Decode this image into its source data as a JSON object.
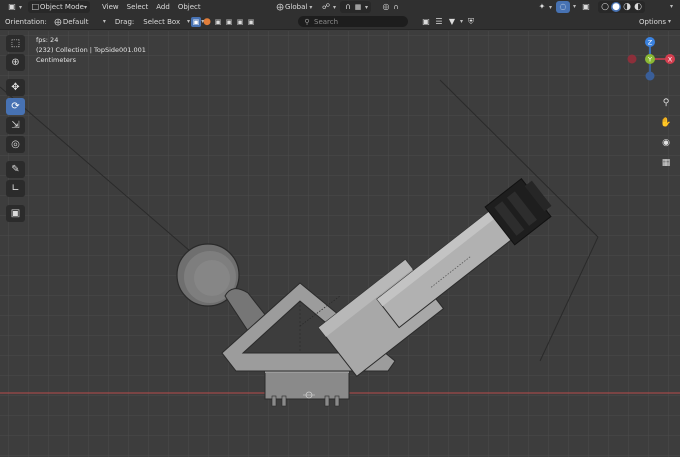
{
  "header": {
    "editor_type_icon": "viewport-editor-icon",
    "mode": "Object Mode",
    "menus": [
      "View",
      "Select",
      "Add",
      "Object"
    ],
    "transform_orientation": "Global",
    "pivot_icon": "pivot-icon",
    "snap_icon": "magnet-icon"
  },
  "subheader": {
    "orientation_label": "Orientation:",
    "orientation_value": "Default",
    "drag_label": "Drag:",
    "drag_value": "Select Box",
    "search_placeholder": "Search",
    "options_label": "Options"
  },
  "viewport_info": {
    "fps": "fps: 24",
    "collection": "(232) Collection | TopSide001.001",
    "units": "Centimeters"
  },
  "gizmo": {
    "x_label": "X",
    "y_label": "Y",
    "z_label": "Z",
    "x_color": "#d43e4f",
    "y_color": "#8ab834",
    "z_color": "#3a82e0"
  },
  "tools": [
    {
      "name": "select-box-tool",
      "icon": "select-box-icon",
      "active": false
    },
    {
      "name": "cursor-tool",
      "icon": "cursor-icon",
      "active": false
    },
    {
      "name": "move-tool",
      "icon": "move-icon",
      "active": false
    },
    {
      "name": "rotate-tool",
      "icon": "rotate-icon",
      "active": true
    },
    {
      "name": "scale-tool",
      "icon": "scale-icon",
      "active": false
    },
    {
      "name": "transform-tool",
      "icon": "transform-icon",
      "active": false
    },
    {
      "name": "annotate-tool",
      "icon": "annotate-icon",
      "active": false
    },
    {
      "name": "measure-tool",
      "icon": "measure-icon",
      "active": false
    },
    {
      "name": "add-cube-tool",
      "icon": "add-cube-icon",
      "active": false
    }
  ],
  "nav_buttons": [
    {
      "name": "zoom-icon"
    },
    {
      "name": "pan-hand-icon"
    },
    {
      "name": "camera-view-icon"
    },
    {
      "name": "orthographic-grid-icon"
    }
  ],
  "colors": {
    "accent": "#4772b3",
    "background": "#3d3d3d",
    "x_axis": "#b84a4a",
    "model_light": "#a8a8a8"
  }
}
